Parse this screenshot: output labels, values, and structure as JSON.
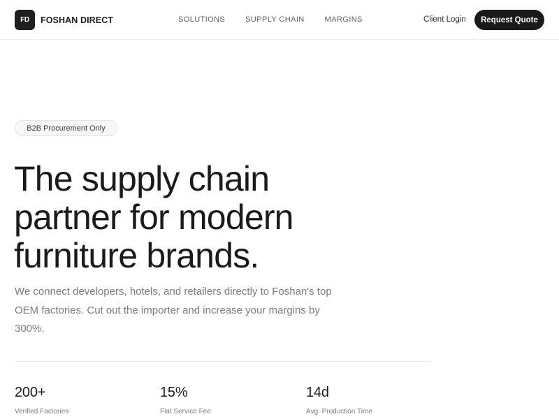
{
  "header": {
    "logo_text": "FD",
    "brand_name": "FOSHAN DIRECT",
    "nav": [
      "SOLUTIONS",
      "SUPPLY CHAIN",
      "MARGINS"
    ],
    "client_login": "Client Login",
    "cta": "Request Quote"
  },
  "hero": {
    "badge": "B2B Procurement Only",
    "title_lines": [
      "The supply chain",
      "partner for modern",
      "furniture brands."
    ],
    "subtitle": "We connect developers, hotels, and retailers directly to Foshan's top OEM factories. Cut out the importer and increase your margins by 300%."
  },
  "stats": [
    {
      "value": "200+",
      "label": "Verified Factories"
    },
    {
      "value": "15%",
      "label": "Flat Service Fee"
    },
    {
      "value": "14d",
      "label": "Avg. Production Time"
    }
  ],
  "colors": {
    "primary_dark": "#1a1a1c",
    "muted_text": "#7a7a80",
    "border": "#ececee"
  }
}
